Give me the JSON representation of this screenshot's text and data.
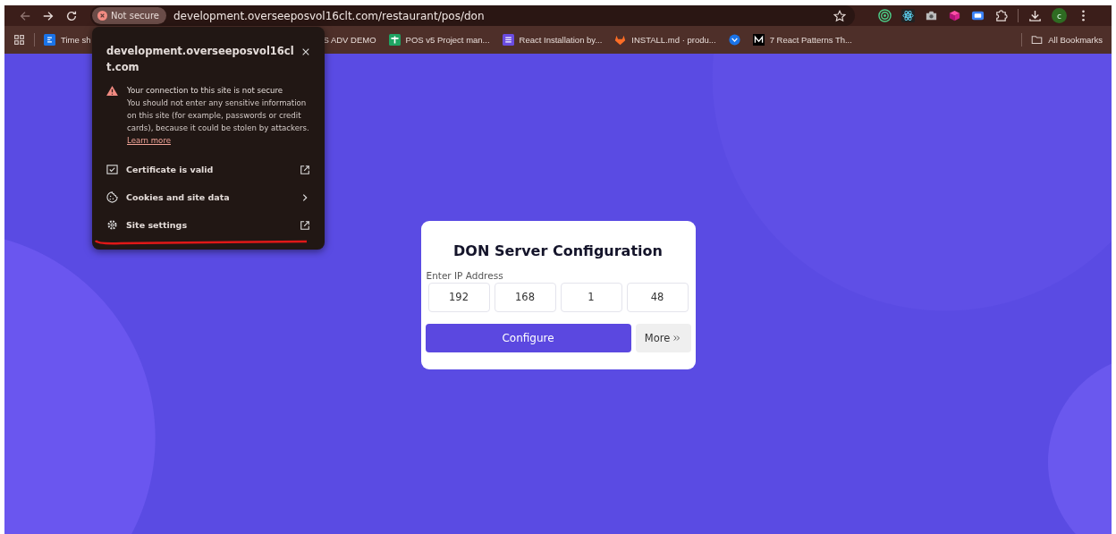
{
  "browser": {
    "security_chip": "Not secure",
    "url": "development.overseeposvol16clt.com/restaurant/pos/don",
    "profile_initial": "c"
  },
  "bookmarks": [
    {
      "kind": "labeled",
      "label": "Time sh"
    },
    {
      "kind": "labeled",
      "label": "S ADV DEMO"
    },
    {
      "kind": "labeled",
      "label": "POS v5 Project man..."
    },
    {
      "kind": "labeled",
      "label": "React Installation by..."
    },
    {
      "kind": "labeled",
      "label": "INSTALL.md · produ..."
    },
    {
      "kind": "icon_only"
    },
    {
      "kind": "labeled",
      "label": "7 React Patterns Th..."
    }
  ],
  "all_bookmarks": "All Bookmarks",
  "site_popup": {
    "title": "development.overseeposvol16clt.com",
    "warning_title": "Your connection to this site is not secure",
    "warning_text": "You should not enter any sensitive information on this site (for example, passwords or credit cards), because it could be stolen by attackers.",
    "learn_more": "Learn more",
    "items": [
      {
        "label": "Certificate is valid",
        "kind": "external"
      },
      {
        "label": "Cookies and site data",
        "kind": "chevron"
      },
      {
        "label": "Site settings",
        "kind": "external"
      }
    ]
  },
  "config": {
    "title": "DON Server Configuration",
    "ip_label": "Enter IP Address",
    "octets": [
      "192",
      "168",
      "1",
      "48"
    ],
    "configure": "Configure",
    "more": "More"
  }
}
